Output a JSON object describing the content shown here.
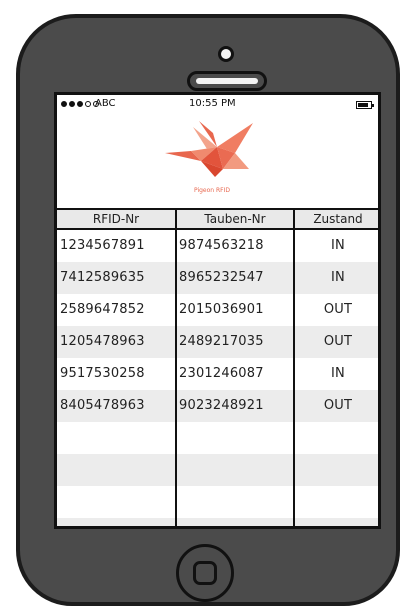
{
  "status": {
    "carrier": "ABC",
    "time": "10:55 PM",
    "signal_dots_filled": 3,
    "signal_dots_total": 5,
    "battery_level": 0.8
  },
  "header": {
    "logo_text": "Pigeon RFID",
    "accent_color": "#e8674e"
  },
  "table": {
    "columns": [
      "RFID-Nr",
      "Tauben-Nr",
      "Zustand"
    ],
    "rows": [
      [
        "1234567891",
        "9874563218",
        "IN"
      ],
      [
        "7412589635",
        "8965232547",
        "IN"
      ],
      [
        "2589647852",
        "2015036901",
        "OUT"
      ],
      [
        "1205478963",
        "2489217035",
        "OUT"
      ],
      [
        "9517530258",
        "2301246087",
        "IN"
      ],
      [
        "8405478963",
        "9023248921",
        "OUT"
      ],
      [
        "",
        "",
        ""
      ],
      [
        "",
        "",
        ""
      ],
      [
        "",
        "",
        ""
      ],
      [
        "",
        "",
        ""
      ]
    ]
  }
}
